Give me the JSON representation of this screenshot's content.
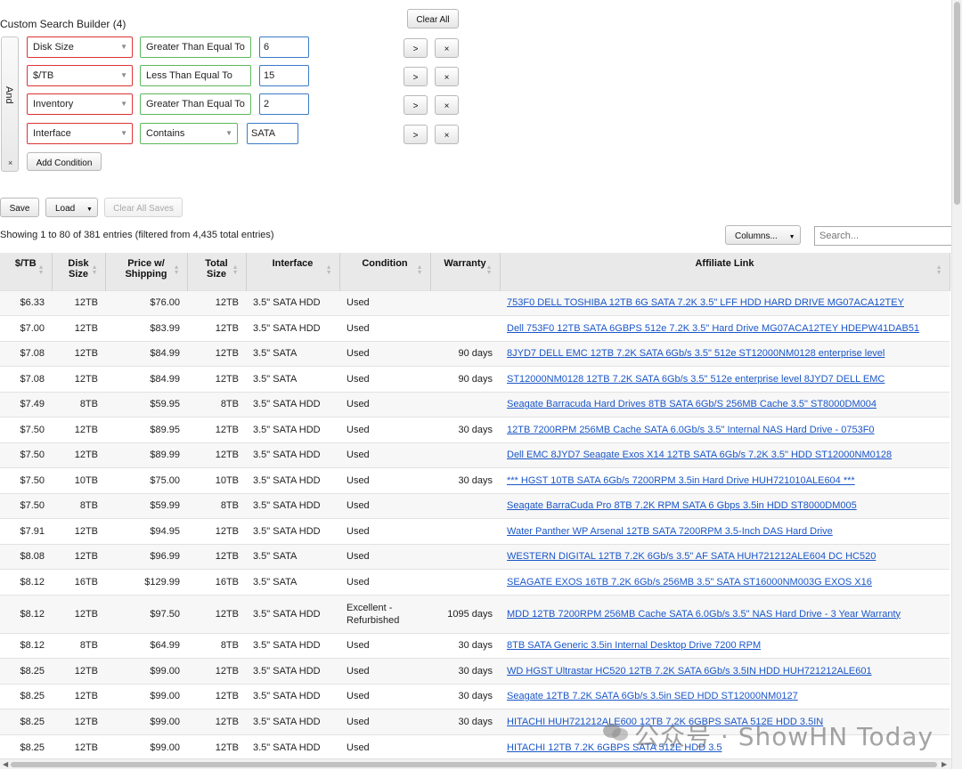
{
  "builder": {
    "title": "Custom Search Builder (4)",
    "logic_label": "And",
    "logic_close": "×",
    "clear_all": "Clear All",
    "add_condition": "Add Condition",
    "conditions": [
      {
        "field": "Disk Size",
        "op": "Greater Than Equal To",
        "value": "6"
      },
      {
        "field": "$/TB",
        "op": "Less Than Equal To",
        "value": "15"
      },
      {
        "field": "Inventory",
        "op": "Greater Than Equal To",
        "value": "2"
      },
      {
        "field": "Interface",
        "op": "Contains",
        "value": "SATA"
      }
    ],
    "indent_label": ">",
    "delete_label": "×"
  },
  "saves": {
    "save": "Save",
    "load": "Load",
    "load_caret": "▼",
    "clear_all_saves": "Clear All Saves"
  },
  "table_info": "Showing 1 to 80 of 381 entries (filtered from 4,435 total entries)",
  "columns_button": "Columns...",
  "columns_caret": "▼",
  "search": {
    "placeholder": "Search..."
  },
  "table": {
    "headers": [
      "$/TB",
      "Disk Size",
      "Price w/ Shipping",
      "Total Size",
      "Interface",
      "Condition",
      "Warranty",
      "Affiliate Link"
    ],
    "rows": [
      [
        "$6.33",
        "12TB",
        "$76.00",
        "12TB",
        "3.5\" SATA HDD",
        "Used",
        "",
        "753F0 DELL TOSHIBA 12TB 6G SATA 7.2K 3.5\" LFF HDD HARD DRIVE MG07ACA12TEY"
      ],
      [
        "$7.00",
        "12TB",
        "$83.99",
        "12TB",
        "3.5\" SATA HDD",
        "Used",
        "",
        "Dell 753F0 12TB SATA 6GBPS 512e 7.2K 3.5\" Hard Drive MG07ACA12TEY HDEPW41DAB51"
      ],
      [
        "$7.08",
        "12TB",
        "$84.99",
        "12TB",
        "3.5\" SATA",
        "Used",
        "90 days",
        "8JYD7 DELL EMC 12TB 7.2K SATA 6Gb/s 3.5\" 512e ST12000NM0128 enterprise level"
      ],
      [
        "$7.08",
        "12TB",
        "$84.99",
        "12TB",
        "3.5\" SATA",
        "Used",
        "90 days",
        "ST12000NM0128 12TB 7.2K SATA 6Gb/s 3.5\" 512e enterprise level 8JYD7 DELL EMC"
      ],
      [
        "$7.49",
        "8TB",
        "$59.95",
        "8TB",
        "3.5\" SATA HDD",
        "Used",
        "",
        "Seagate Barracuda Hard Drives 8TB SATA 6Gb/S 256MB Cache 3.5\" ST8000DM004"
      ],
      [
        "$7.50",
        "12TB",
        "$89.95",
        "12TB",
        "3.5\" SATA HDD",
        "Used",
        "30 days",
        "12TB 7200RPM 256MB Cache SATA 6.0Gb/s 3.5\" Internal NAS Hard Drive - 0753F0"
      ],
      [
        "$7.50",
        "12TB",
        "$89.99",
        "12TB",
        "3.5\" SATA HDD",
        "Used",
        "",
        "Dell EMC 8JYD7 Seagate Exos X14 12TB SATA 6Gb/s 7.2K 3.5\" HDD ST12000NM0128"
      ],
      [
        "$7.50",
        "10TB",
        "$75.00",
        "10TB",
        "3.5\" SATA HDD",
        "Used",
        "30 days",
        "*** HGST 10TB SATA 6Gb/s 7200RPM 3.5in Hard Drive HUH721010ALE604 ***"
      ],
      [
        "$7.50",
        "8TB",
        "$59.99",
        "8TB",
        "3.5\" SATA HDD",
        "Used",
        "",
        "Seagate BarraCuda Pro 8TB 7.2K RPM SATA 6 Gbps 3.5in HDD ST8000DM005"
      ],
      [
        "$7.91",
        "12TB",
        "$94.95",
        "12TB",
        "3.5\" SATA HDD",
        "Used",
        "",
        "Water Panther WP Arsenal 12TB SATA 7200RPM 3.5-Inch DAS Hard Drive"
      ],
      [
        "$8.08",
        "12TB",
        "$96.99",
        "12TB",
        "3.5\" SATA",
        "Used",
        "",
        "WESTERN DIGITAL 12TB 7.2K 6Gb/s 3.5\" AF SATA HUH721212ALE604 DC HC520"
      ],
      [
        "$8.12",
        "16TB",
        "$129.99",
        "16TB",
        "3.5\" SATA",
        "Used",
        "",
        "SEAGATE EXOS 16TB 7.2K 6Gb/s 256MB 3.5\" SATA ST16000NM003G EXOS X16"
      ],
      [
        "$8.12",
        "12TB",
        "$97.50",
        "12TB",
        "3.5\" SATA HDD",
        "Excellent - Refurbished",
        "1095 days",
        "MDD 12TB 7200RPM 256MB Cache SATA 6.0Gb/s 3.5\" NAS Hard Drive - 3 Year Warranty"
      ],
      [
        "$8.12",
        "8TB",
        "$64.99",
        "8TB",
        "3.5\" SATA HDD",
        "Used",
        "30 days",
        "8TB SATA Generic 3.5in Internal Desktop Drive 7200 RPM"
      ],
      [
        "$8.25",
        "12TB",
        "$99.00",
        "12TB",
        "3.5\" SATA HDD",
        "Used",
        "30 days",
        "WD HGST Ultrastar HC520 12TB 7.2K SATA 6Gb/s 3.5IN HDD HUH721212ALE601"
      ],
      [
        "$8.25",
        "12TB",
        "$99.00",
        "12TB",
        "3.5\" SATA HDD",
        "Used",
        "30 days",
        "Seagate 12TB 7.2K SATA 6Gb/s 3.5in SED HDD ST12000NM0127"
      ],
      [
        "$8.25",
        "12TB",
        "$99.00",
        "12TB",
        "3.5\" SATA HDD",
        "Used",
        "30 days",
        "HITACHI HUH721212ALE600 12TB 7.2K 6GBPS SATA 512E HDD 3.5IN"
      ],
      [
        "$8.25",
        "12TB",
        "$99.00",
        "12TB",
        "3.5\" SATA HDD",
        "Used",
        "",
        "HITACHI 12TB 7.2K 6GBPS SATA 512E HDD 3.5"
      ]
    ]
  },
  "watermark": "公众号 · ShowHN Today",
  "colors": {
    "invalid_border": "#dd3333",
    "valid_border": "#5cb85c",
    "value_border": "#3b7bc8",
    "link": "#1a56c8"
  }
}
